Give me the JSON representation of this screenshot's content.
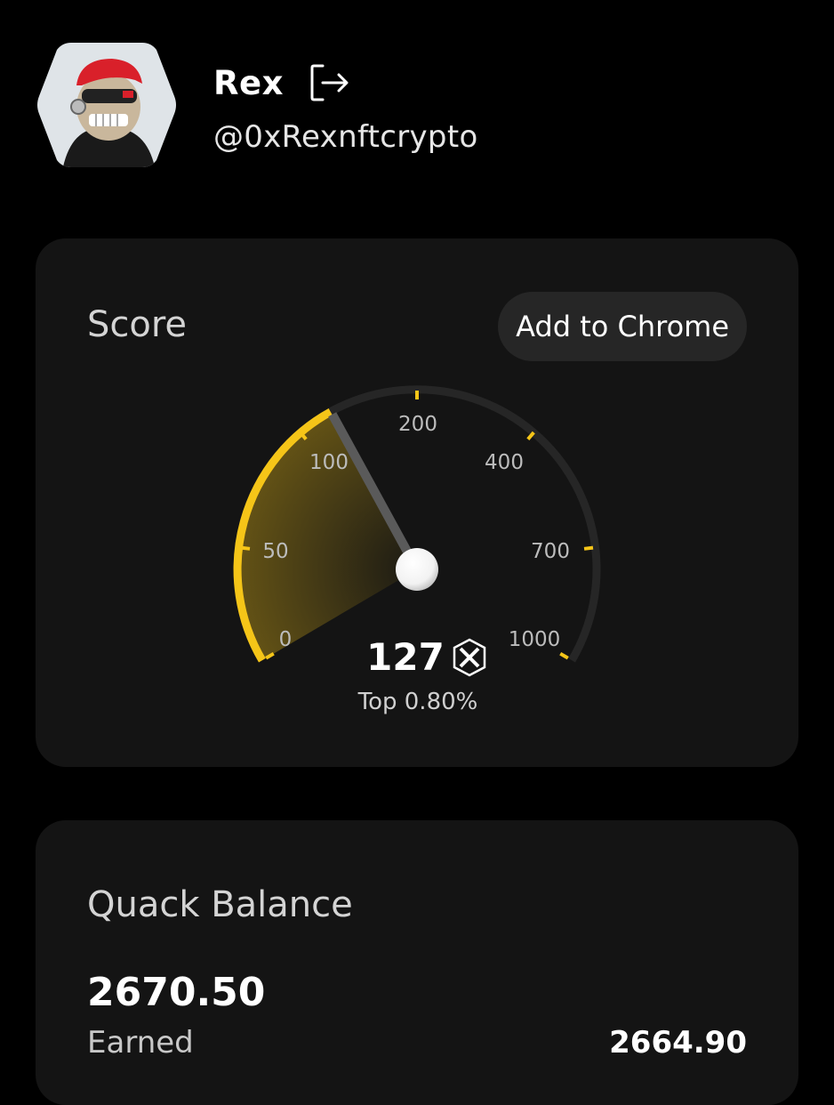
{
  "profile": {
    "name": "Rex",
    "handle": "@0xRexnftcrypto"
  },
  "score_card": {
    "title": "Score",
    "add_button": "Add to Chrome",
    "score": "127",
    "rank": "Top 0.80%",
    "gauge": {
      "ticks": [
        "0",
        "50",
        "100",
        "200",
        "400",
        "700",
        "1000"
      ],
      "value": 127,
      "fill_fraction": 0.235
    }
  },
  "balance_card": {
    "title": "Quack Balance",
    "balance": "2670.50",
    "earned_label": "Earned",
    "earned_value": "2664.90"
  },
  "colors": {
    "background": "#000000",
    "card": "#141414",
    "accent": "#f5c518",
    "track": "#262626"
  }
}
